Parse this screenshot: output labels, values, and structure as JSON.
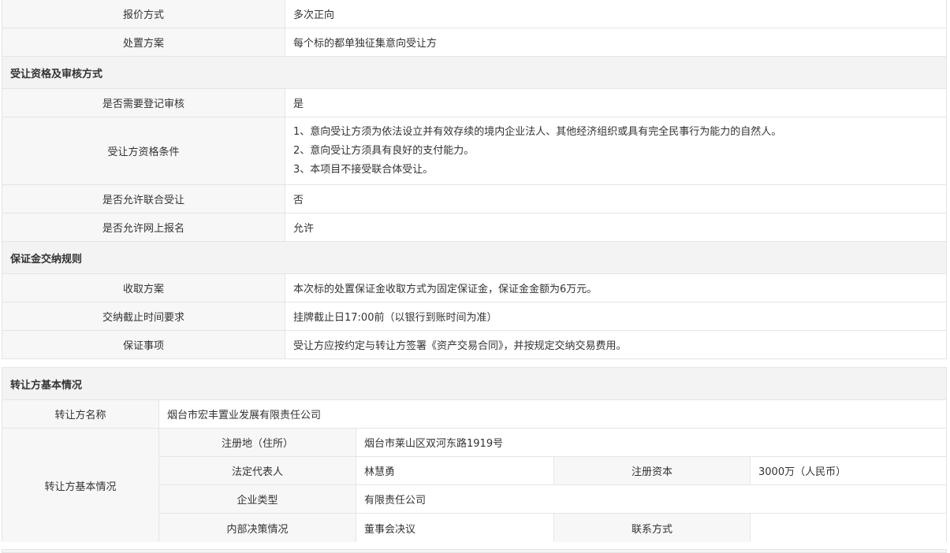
{
  "disposal": {
    "rows": [
      {
        "label": "报价方式",
        "value": "多次正向"
      },
      {
        "label": "处置方案",
        "value": "每个标的都单独征集意向受让方"
      }
    ]
  },
  "qualification": {
    "title": "受让资格及审核方式",
    "register_review": {
      "label": "是否需要登记审核",
      "value": "是"
    },
    "conditions": {
      "label": "受让方资格条件",
      "lines": [
        "1、意向受让方须为依法设立并有效存续的境内企业法人、其他经济组织或具有完全民事行为能力的自然人。",
        "2、意向受让方须具有良好的支付能力。",
        "3、本项目不接受联合体受让。"
      ]
    },
    "joint": {
      "label": "是否允许联合受让",
      "value": "否"
    },
    "online": {
      "label": "是否允许网上报名",
      "value": "允许"
    }
  },
  "deposit": {
    "title": "保证金交纳规则",
    "rows": [
      {
        "label": "收取方案",
        "value": "本次标的处置保证金收取方式为固定保证金，保证金金额为6万元。"
      },
      {
        "label": "交纳截止时间要求",
        "value": "挂牌截止日17:00前（以银行到账时间为准）"
      },
      {
        "label": "保证事项",
        "value": "受让方应按约定与转让方签署《资产交易合同》，并按规定交纳交易费用。"
      }
    ]
  },
  "transferor": {
    "title": "转让方基本情况",
    "name_label": "转让方名称",
    "name_value": "烟台市宏丰置业发展有限责任公司",
    "group_label": "转让方基本情况",
    "address_label": "注册地（住所）",
    "address_value": "烟台市莱山区双河东路1919号",
    "legal_rep_label": "法定代表人",
    "legal_rep_value": "林慧勇",
    "capital_label": "注册资本",
    "capital_value": "3000万（人民币）",
    "type_label": "企业类型",
    "type_value": "有限责任公司",
    "decision_label": "内部决策情况",
    "decision_value": "董事会决议",
    "contact_label": "联系方式",
    "contact_value": ""
  }
}
